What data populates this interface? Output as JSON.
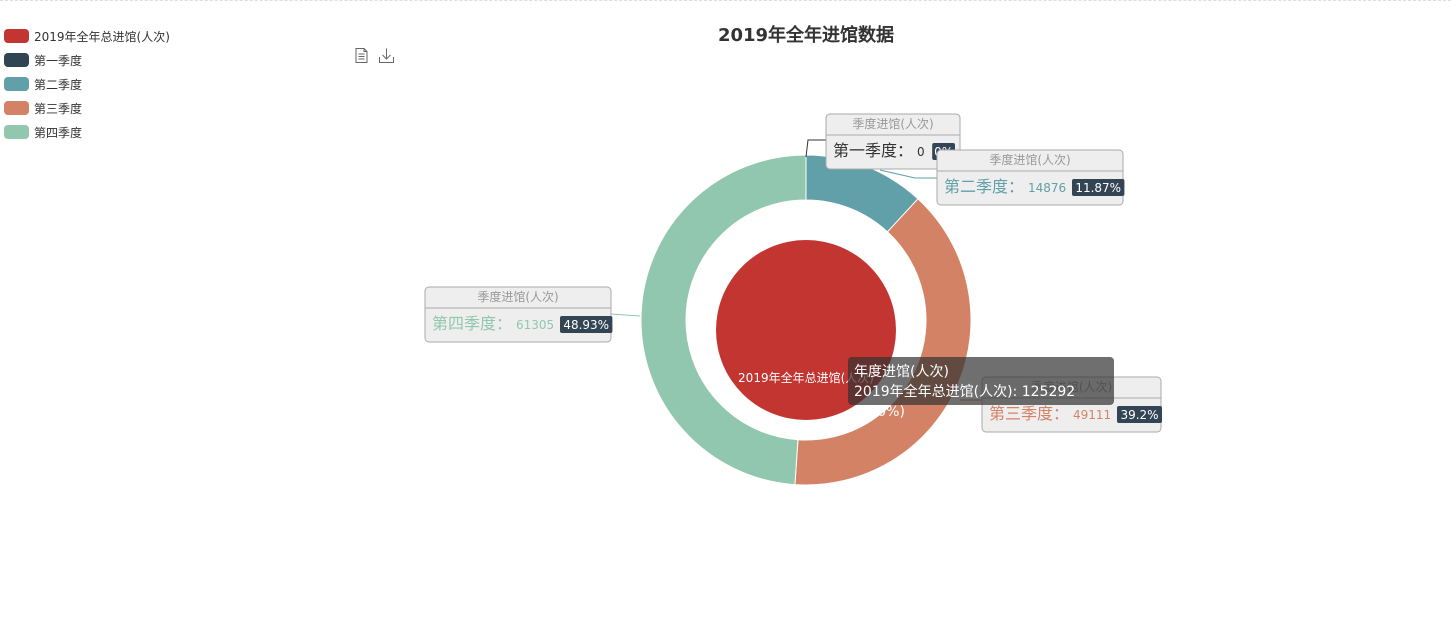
{
  "title": "2019年全年进馆数据",
  "legend": [
    {
      "label": "2019年全年总进馆(人次)",
      "color": "#c23531"
    },
    {
      "label": "第一季度",
      "color": "#2f4554"
    },
    {
      "label": "第二季度",
      "color": "#61a0a8"
    },
    {
      "label": "第三季度",
      "color": "#d48265"
    },
    {
      "label": "第四季度",
      "color": "#91c7ae"
    }
  ],
  "toolbox": [
    {
      "name": "data-view-icon"
    },
    {
      "name": "save-image-icon"
    }
  ],
  "chart_data": {
    "type": "pie",
    "series": [
      {
        "name": "年度进馆(人次)",
        "kind": "inner-pie",
        "data": [
          {
            "name": "2019年全年总进馆(人次)",
            "value": 125292,
            "percent": "100%",
            "color": "#c23531"
          }
        ],
        "inner_label": "2019年全年总进馆(人次)"
      },
      {
        "name": "季度进馆(人次)",
        "kind": "donut",
        "data": [
          {
            "name": "第一季度",
            "value": 0,
            "percent": "0%",
            "color": "#2f4554"
          },
          {
            "name": "第二季度",
            "value": 14876,
            "percent": "11.87%",
            "color": "#61a0a8"
          },
          {
            "name": "第三季度",
            "value": 49111,
            "percent": "39.2%",
            "color": "#d48265"
          },
          {
            "name": "第四季度",
            "value": 61305,
            "percent": "48.93%",
            "color": "#91c7ae"
          }
        ]
      }
    ]
  },
  "tooltip": {
    "series_name": "年度进馆(人次)",
    "line": "2019年全年总进馆(人次): 125292 (100%)"
  }
}
